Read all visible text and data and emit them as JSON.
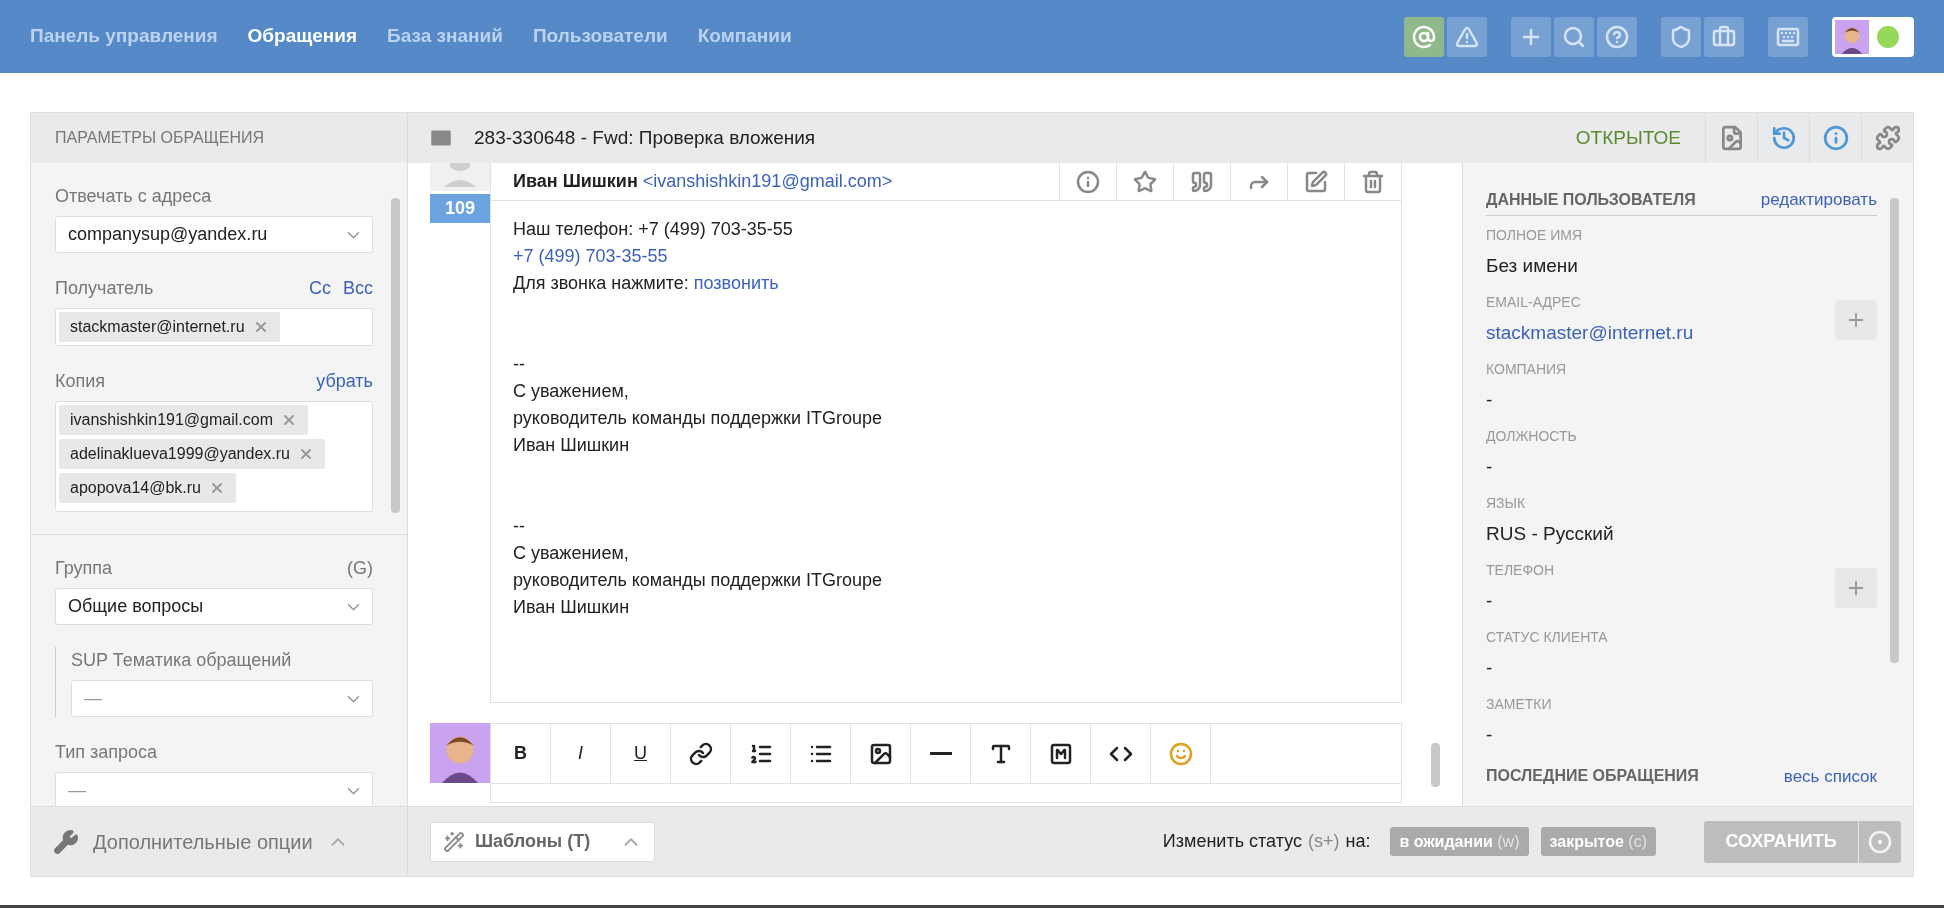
{
  "nav": [
    {
      "label": "Панель управления",
      "selected": false
    },
    {
      "label": "Обращения",
      "selected": true
    },
    {
      "label": "База знаний",
      "selected": false
    },
    {
      "label": "Пользователи",
      "selected": false
    },
    {
      "label": "Компании",
      "selected": false
    }
  ],
  "top_tools": [
    [
      {
        "kind": "mention",
        "selected": true
      },
      {
        "kind": "alert",
        "selected": false
      }
    ],
    [
      {
        "kind": "plus",
        "selected": false
      },
      {
        "kind": "search",
        "selected": false
      },
      {
        "kind": "help",
        "selected": false
      }
    ],
    [
      {
        "kind": "badge",
        "selected": false
      },
      {
        "kind": "briefcase",
        "selected": false
      }
    ],
    [
      {
        "kind": "keyboard",
        "selected": false
      }
    ]
  ],
  "user_menu": {
    "online": true
  },
  "ticket_params": {
    "title": "ПАРАМЕТРЫ ОБРАЩЕНИЯ",
    "reply_from": {
      "label": "Отвечать с адреса",
      "value": "companysup@yandex.ru"
    },
    "recipient": {
      "label": "Получатель",
      "links": [
        "Cc",
        "Bcc"
      ],
      "tags": [
        "stackmaster@internet.ru"
      ]
    },
    "copy": {
      "label": "Копия",
      "link": "убрать",
      "tags": [
        "ivanshishkin191@gmail.com",
        "adelinaklueva1999@yandex.ru",
        "apopova14@bk.ru"
      ]
    },
    "group": {
      "label": "Группа",
      "hint": "(G)",
      "value": "Общие вопросы"
    },
    "topic": {
      "label": "SUP Тематика обращений",
      "placeholder": "—"
    },
    "request_type": {
      "label": "Тип запроса",
      "placeholder": "—"
    },
    "more_options": "Дополнительные опции"
  },
  "ticket": {
    "subject": "283-330648 - Fwd: Проверка вложения",
    "status": "ОТКРЫТОЕ",
    "tools": [
      {
        "kind": "image-file",
        "active": false
      },
      {
        "kind": "history",
        "active": true
      },
      {
        "kind": "info",
        "active": true
      },
      {
        "kind": "puzzle",
        "active": false
      }
    ]
  },
  "message": {
    "author": "Иван Шишкин",
    "email": "<ivanshishkin191@gmail.com>",
    "number": "109",
    "actions": [
      {
        "kind": "info"
      },
      {
        "kind": "star"
      },
      {
        "kind": "quote"
      },
      {
        "kind": "forward"
      },
      {
        "kind": "edit"
      },
      {
        "kind": "trash"
      }
    ],
    "body": [
      {
        "kind": "text",
        "text": "Наш телефон: +7 (499) 703-35-55"
      },
      {
        "kind": "link",
        "text": "+7 (499) 703-35-55"
      },
      {
        "kind": "text",
        "text": "Для звонка нажмите:",
        "link": "позвонить"
      },
      {
        "kind": "gap"
      },
      {
        "kind": "text",
        "text": "--"
      },
      {
        "kind": "text",
        "text": "С уважением,"
      },
      {
        "kind": "text",
        "text": "руководитель команды поддержки ITGroupe"
      },
      {
        "kind": "text",
        "text": "Иван Шишкин"
      },
      {
        "kind": "gap"
      },
      {
        "kind": "text",
        "text": "--"
      },
      {
        "kind": "text",
        "text": "С уважением,"
      },
      {
        "kind": "text",
        "text": "руководитель команды поддержки ITGroupe"
      },
      {
        "kind": "text",
        "text": "Иван Шишкин"
      }
    ]
  },
  "editor_toolbar": [
    {
      "kind": "bold",
      "label": "B"
    },
    {
      "kind": "italic",
      "label": "I"
    },
    {
      "kind": "underline",
      "label": "U"
    },
    {
      "kind": "link"
    },
    {
      "kind": "ordered-list"
    },
    {
      "kind": "list"
    },
    {
      "kind": "image"
    },
    {
      "kind": "rule"
    },
    {
      "kind": "font"
    },
    {
      "kind": "highlight"
    },
    {
      "kind": "code"
    },
    {
      "kind": "emoji"
    }
  ],
  "user_data": {
    "title": "ДАННЫЕ ПОЛЬЗОВАТЕЛЯ",
    "edit_link": "редактировать",
    "fields": [
      {
        "label": "ПОЛНОЕ ИМЯ",
        "value": "Без имени",
        "kind": "text",
        "addable": false
      },
      {
        "label": "EMAIL-АДРЕС",
        "value": "stackmaster@internet.ru",
        "kind": "link",
        "addable": true
      },
      {
        "label": "КОМПАНИЯ",
        "value": "-",
        "kind": "text",
        "addable": false
      },
      {
        "label": "ДОЛЖНОСТЬ",
        "value": "-",
        "kind": "text",
        "addable": false
      },
      {
        "label": "ЯЗЫК",
        "value": "RUS - Русский",
        "kind": "text",
        "addable": false
      },
      {
        "label": "ТЕЛЕФОН",
        "value": "-",
        "kind": "text",
        "addable": true
      },
      {
        "label": "СТАТУС КЛИЕНТА",
        "value": "-",
        "kind": "text",
        "addable": false
      },
      {
        "label": "ЗАМЕТКИ",
        "value": "-",
        "kind": "text",
        "addable": false
      }
    ],
    "recent_title": "ПОСЛЕДНИЕ ОБРАЩЕНИЯ",
    "recent_link": "весь список"
  },
  "footer": {
    "templates": "Шаблоны (T)",
    "change_status": "Изменить статус",
    "change_status_key": "(s+)",
    "change_status_to": "на:",
    "statuses": [
      {
        "label": "в ожидании",
        "key": "(w)"
      },
      {
        "label": "закрытое",
        "key": "(c)"
      }
    ],
    "save": {
      "label": "СОХРАНИТЬ",
      "disabled": true
    }
  }
}
